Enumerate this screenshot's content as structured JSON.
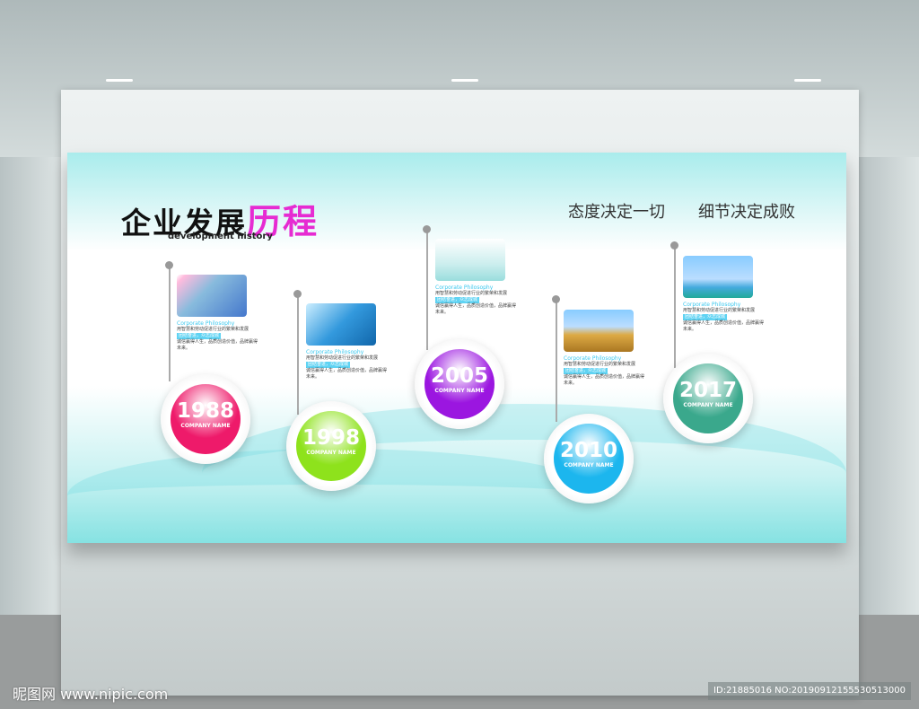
{
  "title": {
    "main": "企业发展",
    "highlight": "历程",
    "subtitle": "development history"
  },
  "slogans": [
    "态度决定一切",
    "细节决定成败"
  ],
  "milestones": [
    {
      "year": "1988",
      "company": "COMPANY NAME",
      "color": "#ee1a6a",
      "heading": "Corporate Philosophy",
      "line1": "用智慧和劳动促进行业的繁荣和发展",
      "line2": "团结奋进，众志成城",
      "line3": "诚信赢得人生，品质创造价值，品牌赢得未来。",
      "image": "handshake-photo"
    },
    {
      "year": "1998",
      "company": "COMPANY NAME",
      "color": "#8ee21c",
      "heading": "Corporate Philosophy",
      "line1": "用智慧和劳动促进行业的繁荣和发展",
      "line2": "团结奋进，众志成城",
      "line3": "诚信赢得人生，品质创造价值，品牌赢得未来。",
      "image": "skyscraper-photo"
    },
    {
      "year": "2005",
      "company": "COMPANY NAME",
      "color": "#9b16e0",
      "heading": "Corporate Philosophy",
      "line1": "用智慧和劳动促进行业的繁荣和发展",
      "line2": "团结奋进，众志成城",
      "line3": "诚信赢得人生，品质创造价值，品牌赢得未来。",
      "image": "businessman-photo"
    },
    {
      "year": "2010",
      "company": "COMPANY NAME",
      "color": "#1cb6ee",
      "heading": "Corporate Philosophy",
      "line1": "用智慧和劳动促进行业的繁荣和发展",
      "line2": "团结奋进，众志成城",
      "line3": "诚信赢得人生，品质创造价值，品牌赢得未来。",
      "image": "wheat-photo"
    },
    {
      "year": "2017",
      "company": "COMPANY NAME",
      "color": "#3aa88c",
      "heading": "Corporate Philosophy",
      "line1": "用智慧和劳动促进行业的繁荣和发展",
      "line2": "团结奋进，众志成城",
      "line3": "诚信赢得人生，品质创造价值，品牌赢得未来。",
      "image": "city-skyline-photo"
    }
  ],
  "watermark": "昵图网 www.nipic.com",
  "image_id": "ID:21885016 NO:20190912155530513000"
}
